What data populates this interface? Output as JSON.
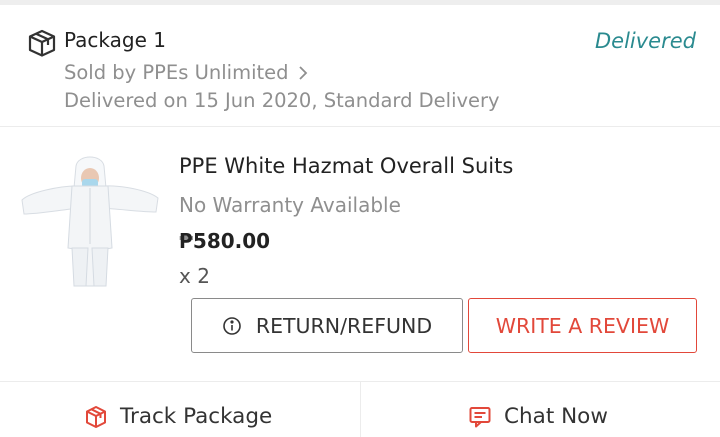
{
  "package": {
    "title": "Package 1",
    "status": "Delivered",
    "sold_by": "Sold by PPEs Unlimited",
    "delivery_info": "Delivered on 15 Jun 2020, Standard Delivery"
  },
  "product": {
    "name": "PPE White Hazmat Overall Suits",
    "warranty": "No Warranty Available",
    "price": "₱580.00",
    "quantity": "x 2"
  },
  "actions": {
    "return_refund": "RETURN/REFUND",
    "write_review": "WRITE A REVIEW"
  },
  "footer": {
    "track_package": "Track Package",
    "chat_now": "Chat Now"
  },
  "colors": {
    "status": "#2a8a8f",
    "accent": "#e2483a"
  },
  "icons": {
    "package": "package-icon",
    "chevron": "chevron-right-icon",
    "info": "info-icon",
    "track": "track-package-icon",
    "chat": "chat-icon"
  }
}
